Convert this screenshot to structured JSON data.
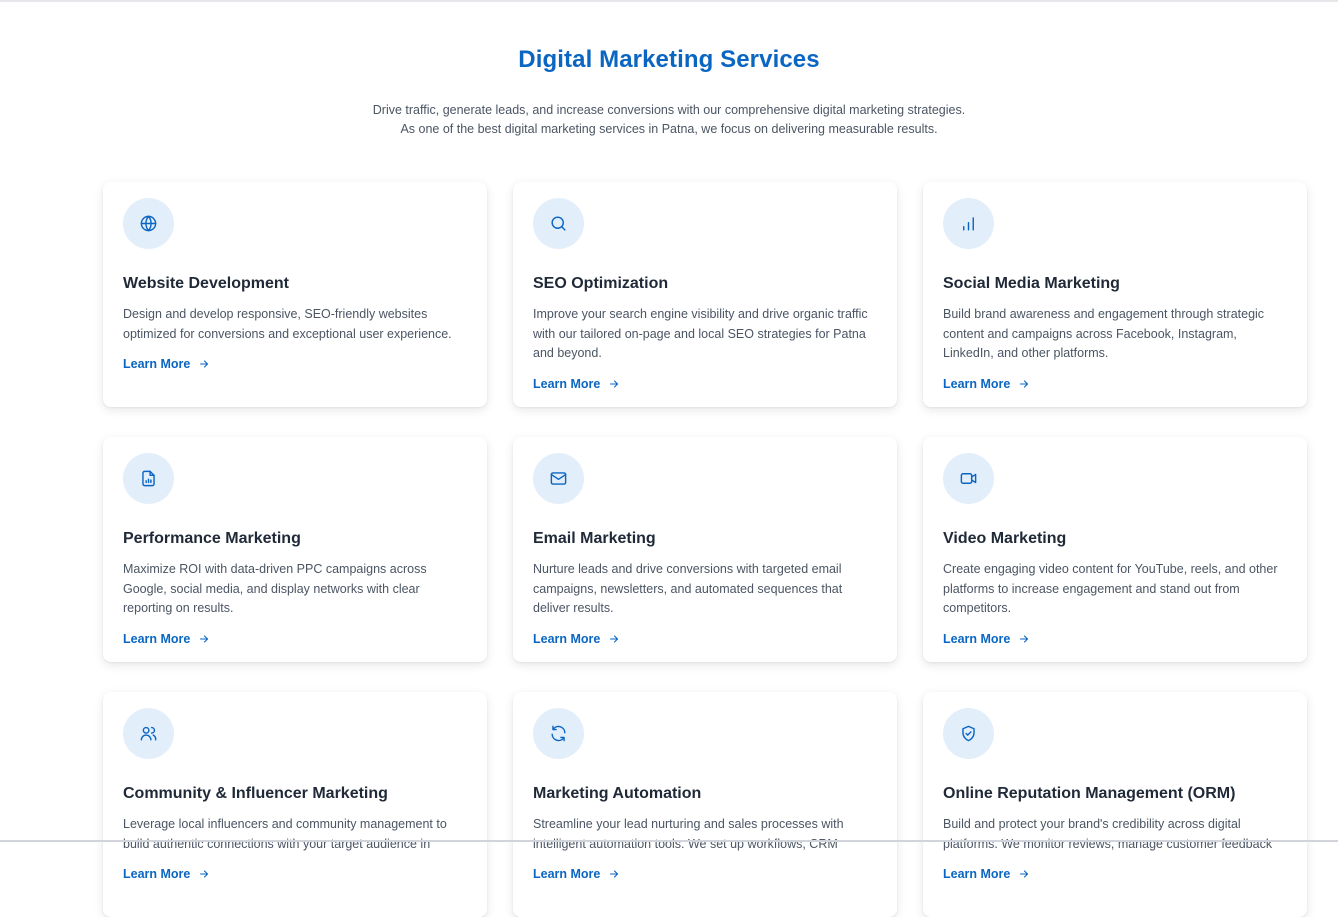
{
  "section": {
    "title": "Digital Marketing Services",
    "subtitle_line1": "Drive traffic, generate leads, and increase conversions with our comprehensive digital marketing strategies.",
    "subtitle_line2": "As one of the best digital marketing services in Patna, we focus on delivering measurable results."
  },
  "services": [
    {
      "icon": "globe-icon",
      "title": "Website Development",
      "description": "Design and develop responsive, SEO-friendly websites optimized for conversions and exceptional user experience.",
      "link": "Learn More"
    },
    {
      "icon": "search-icon",
      "title": "SEO Optimization",
      "description": "Improve your search engine visibility and drive organic traffic with our tailored on-page and local SEO strategies for Patna and beyond.",
      "link": "Learn More"
    },
    {
      "icon": "bar-chart-icon",
      "title": "Social Media Marketing",
      "description": "Build brand awareness and engagement through strategic content and campaigns across Facebook, Instagram, LinkedIn, and other platforms.",
      "link": "Learn More"
    },
    {
      "icon": "file-chart-icon",
      "title": "Performance Marketing",
      "description": "Maximize ROI with data-driven PPC campaigns across Google, social media, and display networks with clear reporting on results.",
      "link": "Learn More"
    },
    {
      "icon": "mail-icon",
      "title": "Email Marketing",
      "description": "Nurture leads and drive conversions with targeted email campaigns, newsletters, and automated sequences that deliver results.",
      "link": "Learn More"
    },
    {
      "icon": "video-icon",
      "title": "Video Marketing",
      "description": "Create engaging video content for YouTube, reels, and other platforms to increase engagement and stand out from competitors.",
      "link": "Learn More"
    },
    {
      "icon": "users-icon",
      "title": "Community & Influencer Marketing",
      "description": "Leverage local influencers and community management to build authentic connections with your target audience in",
      "link": "Learn More"
    },
    {
      "icon": "refresh-icon",
      "title": "Marketing Automation",
      "description": "Streamline your lead nurturing and sales processes with intelligent automation tools. We set up workflows, CRM",
      "link": "Learn More"
    },
    {
      "icon": "shield-check-icon",
      "title": "Online Reputation Management (ORM)",
      "description": "Build and protect your brand's credibility across digital platforms. We monitor reviews, manage customer feedback",
      "link": "Learn More"
    }
  ],
  "colors": {
    "accent": "#0a66c2",
    "icon_bg": "#e3eefb"
  }
}
